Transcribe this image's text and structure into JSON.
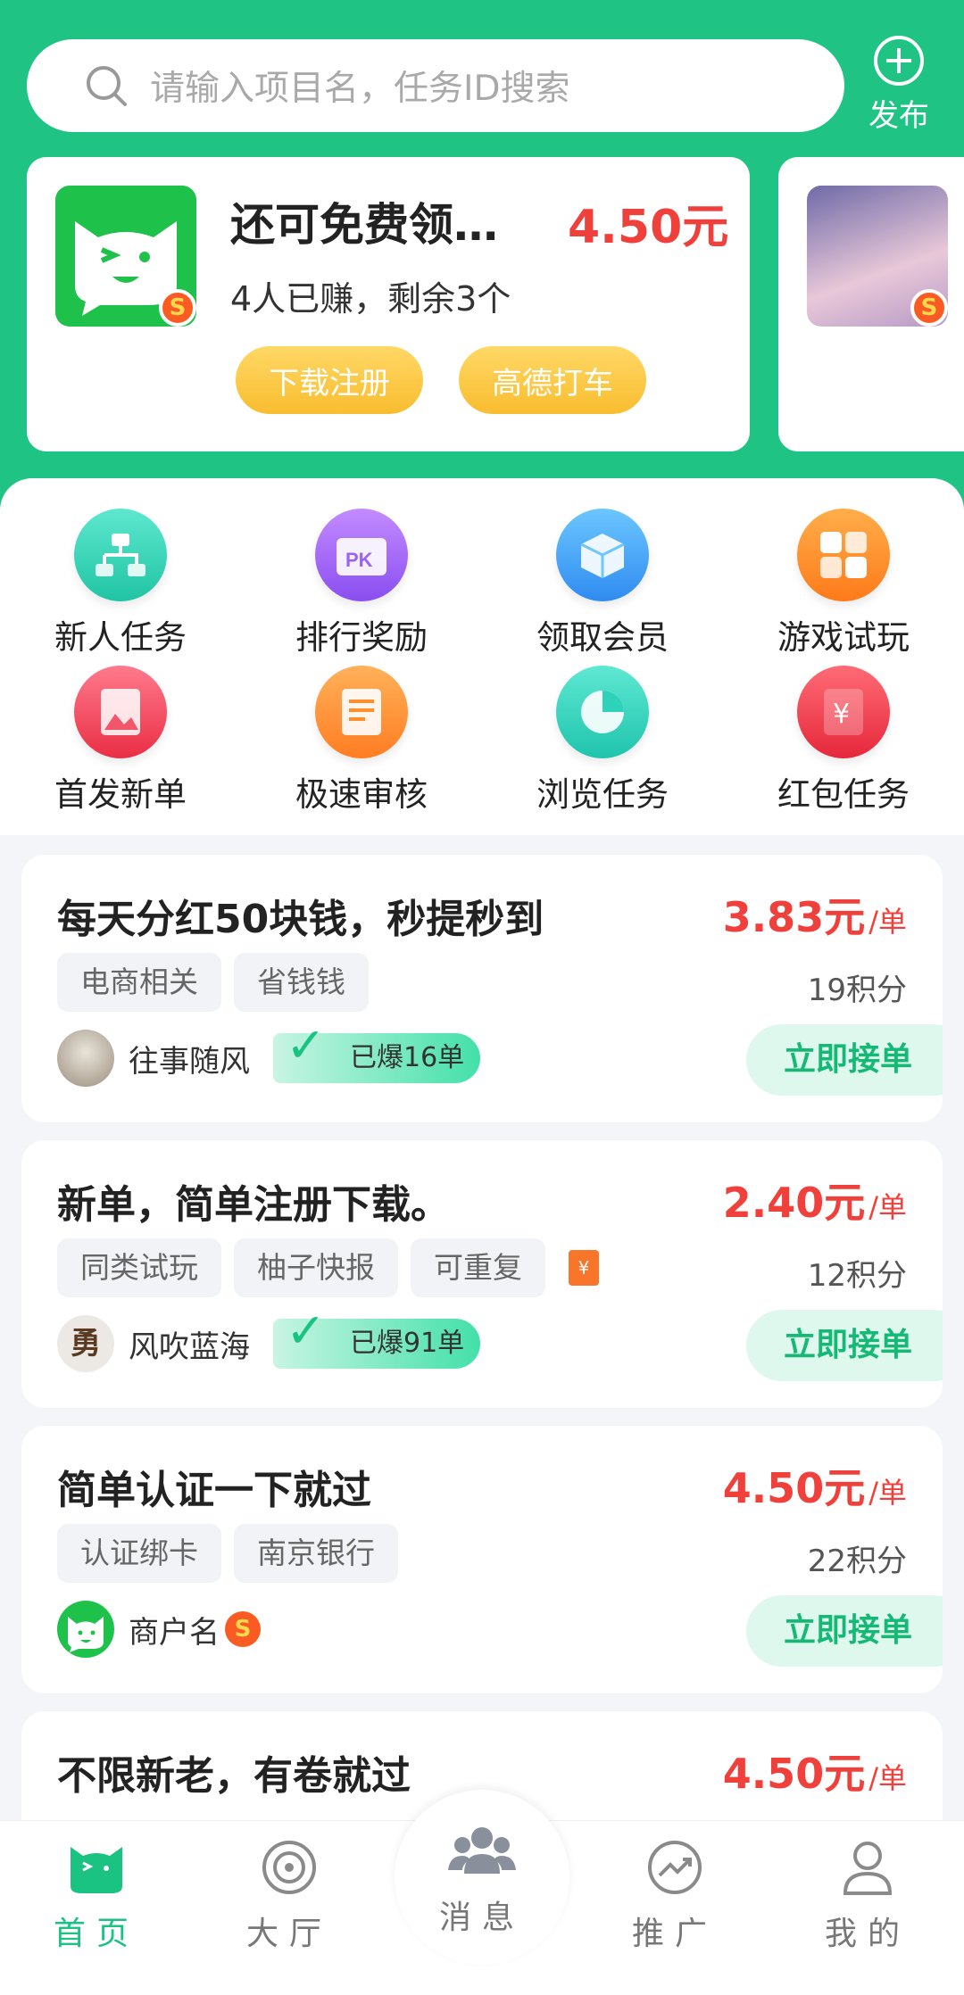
{
  "search": {
    "placeholder": "请输入项目名，任务ID搜索"
  },
  "publish_label": "发布",
  "promo": {
    "title": "还可免费领…",
    "price": "4.50元",
    "subtitle": "4人已赚，剩余3个",
    "tags": [
      "下载注册",
      "高德打车"
    ],
    "badge": "S"
  },
  "grid": [
    {
      "label": "新人任务",
      "icon": "org-chart-icon",
      "color": "#2fd6b5"
    },
    {
      "label": "排行奖励",
      "icon": "pk-icon",
      "color": "#9a62f3"
    },
    {
      "label": "领取会员",
      "icon": "cube-icon",
      "color": "#2f9cf5"
    },
    {
      "label": "游戏试玩",
      "icon": "game-icon",
      "color": "#ff8b24"
    },
    {
      "label": "首发新单",
      "icon": "image-card-icon",
      "color": "#f24458"
    },
    {
      "label": "极速审核",
      "icon": "document-icon",
      "color": "#ff8f2c"
    },
    {
      "label": "浏览任务",
      "icon": "pie-chart-icon",
      "color": "#2ed1b9"
    },
    {
      "label": "红包任务",
      "icon": "red-envelope-icon",
      "color": "#f03a4a"
    }
  ],
  "tasks": [
    {
      "title": "每天分红50块钱，秒提秒到",
      "price": "3.83元",
      "unit": "/单",
      "tags": [
        "电商相关",
        "省钱钱"
      ],
      "points": "19积分",
      "owner": "往事随风",
      "burst": "已爆16单",
      "accept": "立即接单"
    },
    {
      "title": "新单，简单注册下载。",
      "price": "2.40元",
      "unit": "/单",
      "tags": [
        "同类试玩",
        "柚子快报",
        "可重复"
      ],
      "redpack": "¥",
      "points": "12积分",
      "owner": "风吹蓝海",
      "avatar_char": "勇",
      "burst": "已爆91单",
      "accept": "立即接单"
    },
    {
      "title": "简单认证一下就过",
      "price": "4.50元",
      "unit": "/单",
      "tags": [
        "认证绑卡",
        "南京银行"
      ],
      "points": "22积分",
      "owner": "商户名",
      "badge": "S",
      "accept": "立即接单"
    },
    {
      "title": "不限新老，有卷就过",
      "price": "4.50元",
      "unit": "/单"
    }
  ],
  "tabs": [
    {
      "label": "首页",
      "icon": "cat-home-icon"
    },
    {
      "label": "大厅",
      "icon": "target-icon"
    },
    {
      "label": "消息",
      "icon": "people-icon"
    },
    {
      "label": "推广",
      "icon": "trend-icon"
    },
    {
      "label": "我的",
      "icon": "user-icon"
    }
  ],
  "colors": {
    "brand": "#1fc383",
    "price": "#f0403c",
    "tag_gold": "#f9bd2f"
  }
}
